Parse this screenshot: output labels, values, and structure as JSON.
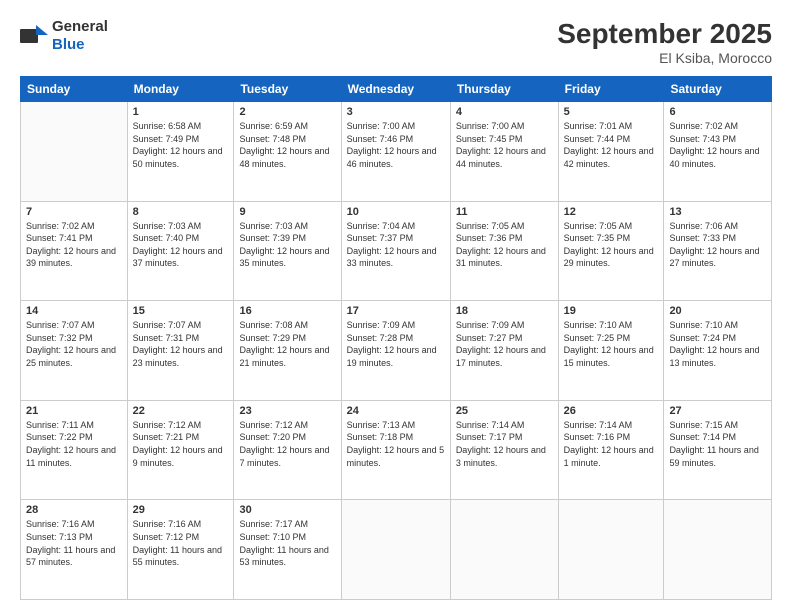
{
  "header": {
    "logo_general": "General",
    "logo_blue": "Blue",
    "month": "September 2025",
    "location": "El Ksiba, Morocco"
  },
  "days_of_week": [
    "Sunday",
    "Monday",
    "Tuesday",
    "Wednesday",
    "Thursday",
    "Friday",
    "Saturday"
  ],
  "weeks": [
    [
      {
        "day": "",
        "sunrise": "",
        "sunset": "",
        "daylight": ""
      },
      {
        "day": "1",
        "sunrise": "Sunrise: 6:58 AM",
        "sunset": "Sunset: 7:49 PM",
        "daylight": "Daylight: 12 hours and 50 minutes."
      },
      {
        "day": "2",
        "sunrise": "Sunrise: 6:59 AM",
        "sunset": "Sunset: 7:48 PM",
        "daylight": "Daylight: 12 hours and 48 minutes."
      },
      {
        "day": "3",
        "sunrise": "Sunrise: 7:00 AM",
        "sunset": "Sunset: 7:46 PM",
        "daylight": "Daylight: 12 hours and 46 minutes."
      },
      {
        "day": "4",
        "sunrise": "Sunrise: 7:00 AM",
        "sunset": "Sunset: 7:45 PM",
        "daylight": "Daylight: 12 hours and 44 minutes."
      },
      {
        "day": "5",
        "sunrise": "Sunrise: 7:01 AM",
        "sunset": "Sunset: 7:44 PM",
        "daylight": "Daylight: 12 hours and 42 minutes."
      },
      {
        "day": "6",
        "sunrise": "Sunrise: 7:02 AM",
        "sunset": "Sunset: 7:43 PM",
        "daylight": "Daylight: 12 hours and 40 minutes."
      }
    ],
    [
      {
        "day": "7",
        "sunrise": "Sunrise: 7:02 AM",
        "sunset": "Sunset: 7:41 PM",
        "daylight": "Daylight: 12 hours and 39 minutes."
      },
      {
        "day": "8",
        "sunrise": "Sunrise: 7:03 AM",
        "sunset": "Sunset: 7:40 PM",
        "daylight": "Daylight: 12 hours and 37 minutes."
      },
      {
        "day": "9",
        "sunrise": "Sunrise: 7:03 AM",
        "sunset": "Sunset: 7:39 PM",
        "daylight": "Daylight: 12 hours and 35 minutes."
      },
      {
        "day": "10",
        "sunrise": "Sunrise: 7:04 AM",
        "sunset": "Sunset: 7:37 PM",
        "daylight": "Daylight: 12 hours and 33 minutes."
      },
      {
        "day": "11",
        "sunrise": "Sunrise: 7:05 AM",
        "sunset": "Sunset: 7:36 PM",
        "daylight": "Daylight: 12 hours and 31 minutes."
      },
      {
        "day": "12",
        "sunrise": "Sunrise: 7:05 AM",
        "sunset": "Sunset: 7:35 PM",
        "daylight": "Daylight: 12 hours and 29 minutes."
      },
      {
        "day": "13",
        "sunrise": "Sunrise: 7:06 AM",
        "sunset": "Sunset: 7:33 PM",
        "daylight": "Daylight: 12 hours and 27 minutes."
      }
    ],
    [
      {
        "day": "14",
        "sunrise": "Sunrise: 7:07 AM",
        "sunset": "Sunset: 7:32 PM",
        "daylight": "Daylight: 12 hours and 25 minutes."
      },
      {
        "day": "15",
        "sunrise": "Sunrise: 7:07 AM",
        "sunset": "Sunset: 7:31 PM",
        "daylight": "Daylight: 12 hours and 23 minutes."
      },
      {
        "day": "16",
        "sunrise": "Sunrise: 7:08 AM",
        "sunset": "Sunset: 7:29 PM",
        "daylight": "Daylight: 12 hours and 21 minutes."
      },
      {
        "day": "17",
        "sunrise": "Sunrise: 7:09 AM",
        "sunset": "Sunset: 7:28 PM",
        "daylight": "Daylight: 12 hours and 19 minutes."
      },
      {
        "day": "18",
        "sunrise": "Sunrise: 7:09 AM",
        "sunset": "Sunset: 7:27 PM",
        "daylight": "Daylight: 12 hours and 17 minutes."
      },
      {
        "day": "19",
        "sunrise": "Sunrise: 7:10 AM",
        "sunset": "Sunset: 7:25 PM",
        "daylight": "Daylight: 12 hours and 15 minutes."
      },
      {
        "day": "20",
        "sunrise": "Sunrise: 7:10 AM",
        "sunset": "Sunset: 7:24 PM",
        "daylight": "Daylight: 12 hours and 13 minutes."
      }
    ],
    [
      {
        "day": "21",
        "sunrise": "Sunrise: 7:11 AM",
        "sunset": "Sunset: 7:22 PM",
        "daylight": "Daylight: 12 hours and 11 minutes."
      },
      {
        "day": "22",
        "sunrise": "Sunrise: 7:12 AM",
        "sunset": "Sunset: 7:21 PM",
        "daylight": "Daylight: 12 hours and 9 minutes."
      },
      {
        "day": "23",
        "sunrise": "Sunrise: 7:12 AM",
        "sunset": "Sunset: 7:20 PM",
        "daylight": "Daylight: 12 hours and 7 minutes."
      },
      {
        "day": "24",
        "sunrise": "Sunrise: 7:13 AM",
        "sunset": "Sunset: 7:18 PM",
        "daylight": "Daylight: 12 hours and 5 minutes."
      },
      {
        "day": "25",
        "sunrise": "Sunrise: 7:14 AM",
        "sunset": "Sunset: 7:17 PM",
        "daylight": "Daylight: 12 hours and 3 minutes."
      },
      {
        "day": "26",
        "sunrise": "Sunrise: 7:14 AM",
        "sunset": "Sunset: 7:16 PM",
        "daylight": "Daylight: 12 hours and 1 minute."
      },
      {
        "day": "27",
        "sunrise": "Sunrise: 7:15 AM",
        "sunset": "Sunset: 7:14 PM",
        "daylight": "Daylight: 11 hours and 59 minutes."
      }
    ],
    [
      {
        "day": "28",
        "sunrise": "Sunrise: 7:16 AM",
        "sunset": "Sunset: 7:13 PM",
        "daylight": "Daylight: 11 hours and 57 minutes."
      },
      {
        "day": "29",
        "sunrise": "Sunrise: 7:16 AM",
        "sunset": "Sunset: 7:12 PM",
        "daylight": "Daylight: 11 hours and 55 minutes."
      },
      {
        "day": "30",
        "sunrise": "Sunrise: 7:17 AM",
        "sunset": "Sunset: 7:10 PM",
        "daylight": "Daylight: 11 hours and 53 minutes."
      },
      {
        "day": "",
        "sunrise": "",
        "sunset": "",
        "daylight": ""
      },
      {
        "day": "",
        "sunrise": "",
        "sunset": "",
        "daylight": ""
      },
      {
        "day": "",
        "sunrise": "",
        "sunset": "",
        "daylight": ""
      },
      {
        "day": "",
        "sunrise": "",
        "sunset": "",
        "daylight": ""
      }
    ]
  ]
}
